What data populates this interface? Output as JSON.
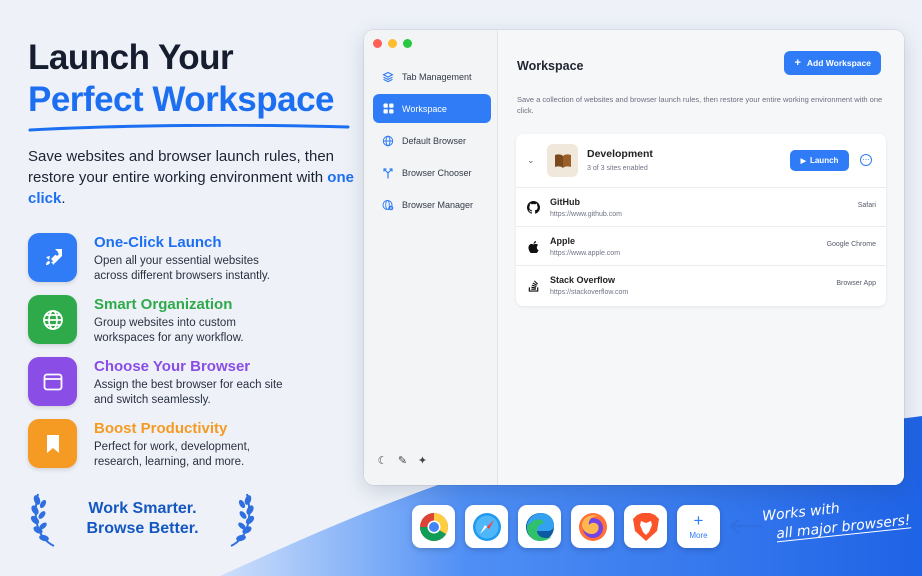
{
  "hero": {
    "line1": "Launch Your",
    "line2": "Perfect Workspace",
    "subtitle_pre": "Save websites and browser launch rules, then restore your entire working environment with ",
    "subtitle_highlight": "one click",
    "subtitle_post": "."
  },
  "features": [
    {
      "title": "One-Click Launch",
      "desc_line1": "Open all your essential websites",
      "desc_line2": "across different browsers instantly.",
      "icon": "rocket-icon",
      "color": "#2f7cf6"
    },
    {
      "title": "Smart Organization",
      "desc_line1": "Group websites into custom",
      "desc_line2": "workspaces for any workflow.",
      "icon": "globe-icon",
      "color": "#2faa4a"
    },
    {
      "title": "Choose Your Browser",
      "desc_line1": "Assign the best browser for each site",
      "desc_line2": "and switch seamlessly.",
      "icon": "browser-window-icon",
      "color": "#8a4ee6"
    },
    {
      "title": "Boost Productivity",
      "desc_line1": "Perfect for work, development,",
      "desc_line2": "research, learning, and more.",
      "icon": "bookmark-icon",
      "color": "#f59a23"
    }
  ],
  "award": {
    "line1": "Work Smarter.",
    "line2": "Browse Better."
  },
  "app": {
    "sidebar": {
      "items": [
        {
          "label": "Tab Management",
          "icon": "layers-icon",
          "active": false
        },
        {
          "label": "Workspace",
          "icon": "grid-icon",
          "active": true
        },
        {
          "label": "Default Browser",
          "icon": "globe-icon",
          "active": false
        },
        {
          "label": "Browser Chooser",
          "icon": "fork-icon",
          "active": false
        },
        {
          "label": "Browser Manager",
          "icon": "globe-settings-icon",
          "active": false
        }
      ],
      "bottom_icons": [
        "moon-icon",
        "brush-icon",
        "sparkle-icon"
      ]
    },
    "main": {
      "title": "Workspace",
      "add_button": "Add Workspace",
      "description": "Save a collection of websites and browser launch rules, then restore your entire working environment with one click.",
      "workspace": {
        "name": "Development",
        "count": "3 of 3 sites enabled",
        "launch_label": "Launch",
        "sites": [
          {
            "name": "GitHub",
            "url": "https://www.github.com",
            "browser": "Safari",
            "icon": "github-icon"
          },
          {
            "name": "Apple",
            "url": "https://www.apple.com",
            "browser": "Google Chrome",
            "icon": "apple-icon"
          },
          {
            "name": "Stack Overflow",
            "url": "https://stackoverflow.com",
            "browser": "Browser App",
            "icon": "stackoverflow-icon"
          }
        ]
      }
    }
  },
  "dock": {
    "apps": [
      "chrome-icon",
      "safari-icon",
      "edge-icon",
      "firefox-icon",
      "brave-icon"
    ],
    "more_label": "More"
  },
  "callout": {
    "line1": "Works with",
    "line2": "all major browsers!"
  },
  "colors": {
    "accent": "#2f7cf6",
    "headline_blue": "#1d6ff2",
    "dark": "#161d2e"
  }
}
